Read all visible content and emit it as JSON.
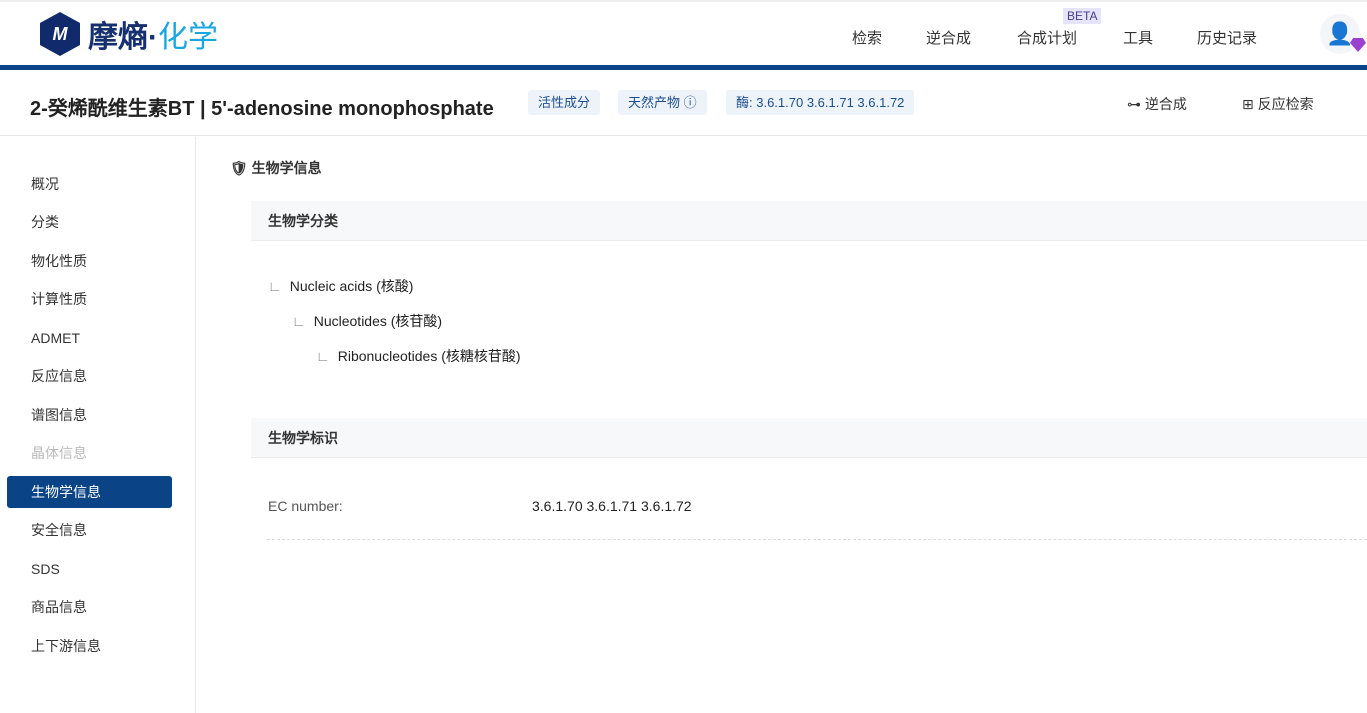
{
  "brand": {
    "mark": "M",
    "name_a": "摩熵·",
    "name_b": "化学"
  },
  "nav": [
    "检索",
    "逆合成",
    "合成计划",
    "工具",
    "历史记录"
  ],
  "beta": "BETA",
  "title": "2-癸烯酰维生素BT | 5'-adenosine monophosphate",
  "tags": [
    "活性成分",
    "天然产物 ⓘ",
    "酶: 3.6.1.70 3.6.1.71 3.6.1.72"
  ],
  "actions": [
    "逆合成",
    "反应检索"
  ],
  "sidebar": [
    "概况",
    "分类",
    "物化性质",
    "计算性质",
    "ADMET",
    "反应信息",
    "谱图信息",
    "晶体信息",
    "生物学信息",
    "安全信息",
    "SDS",
    "商品信息",
    "上下游信息"
  ],
  "section": "生物学信息",
  "classification": {
    "header": "生物学分类",
    "tree": [
      "Nucleic acids (核酸)",
      "Nucleotides (核苷酸)",
      "Ribonucleotides (核糖核苷酸)"
    ]
  },
  "identifiers": {
    "header": "生物学标识",
    "label": "EC number:",
    "value": "3.6.1.70 3.6.1.71 3.6.1.72"
  }
}
